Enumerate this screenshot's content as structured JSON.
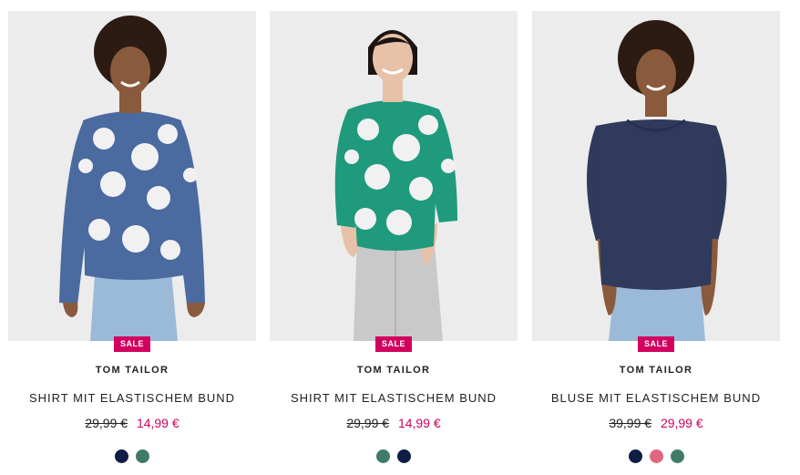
{
  "products": [
    {
      "badge": "SALE",
      "brand": "TOM TAILOR",
      "title": "SHIRT MIT ELASTISCHEM BUND",
      "old_price": "29,99 €",
      "new_price": "14,99 €",
      "image": {
        "top_color": "#4a6aa0",
        "pattern": "white-flowers",
        "bottom": "light-jeans"
      },
      "swatches": [
        {
          "color": "#0f1e45"
        },
        {
          "color": "#3f7b68"
        }
      ]
    },
    {
      "badge": "SALE",
      "brand": "TOM TAILOR",
      "title": "SHIRT MIT ELASTISCHEM BUND",
      "old_price": "29,99 €",
      "new_price": "14,99 €",
      "image": {
        "top_color": "#1f9a7c",
        "pattern": "white-flowers",
        "bottom": "grey-joggers"
      },
      "swatches": [
        {
          "color": "#3f7b68"
        },
        {
          "color": "#0f1e45"
        }
      ]
    },
    {
      "badge": "SALE",
      "brand": "TOM TAILOR",
      "title": "BLUSE MIT ELASTISCHEM BUND",
      "old_price": "39,99 €",
      "new_price": "29,99 €",
      "image": {
        "top_color": "#2f3a5c",
        "pattern": "plain",
        "bottom": "light-jeans"
      },
      "swatches": [
        {
          "color": "#0f1e45"
        },
        {
          "color": "#e06680"
        },
        {
          "color": "#3f7b68"
        }
      ]
    }
  ],
  "colors": {
    "sale": "#d2005f",
    "photo_bg": "#ececec"
  }
}
